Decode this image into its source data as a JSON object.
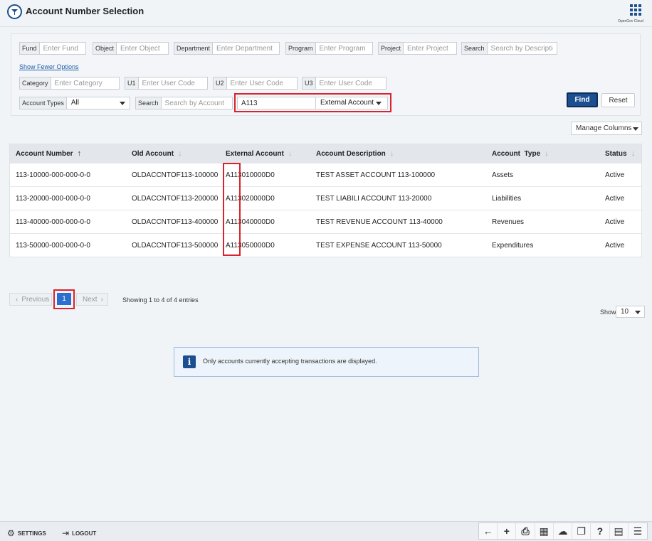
{
  "header": {
    "title": "Account Number Selection",
    "brand": "OpenGov Cloud"
  },
  "filters": {
    "fund": {
      "label": "Fund",
      "placeholder": "Enter Fund"
    },
    "object": {
      "label": "Object",
      "placeholder": "Enter Object"
    },
    "department": {
      "label": "Department",
      "placeholder": "Enter Department"
    },
    "program": {
      "label": "Program",
      "placeholder": "Enter Program"
    },
    "project": {
      "label": "Project",
      "placeholder": "Enter Project"
    },
    "search_desc": {
      "label": "Search",
      "placeholder": "Search by Description"
    },
    "show_fewer": "Show Fewer Options",
    "category": {
      "label": "Category",
      "placeholder": "Enter Category"
    },
    "u1": {
      "label": "U1",
      "placeholder": "Enter User Code"
    },
    "u2": {
      "label": "U2",
      "placeholder": "Enter User Code"
    },
    "u3": {
      "label": "U3",
      "placeholder": "Enter User Code"
    },
    "account_types": {
      "label": "Account Types",
      "value": "All"
    },
    "search_account": {
      "label": "Search",
      "placeholder": "Search by Account"
    },
    "account_value": "A113",
    "account_field_type": "External Account",
    "find_label": "Find",
    "reset_label": "Reset"
  },
  "manage_columns": "Manage Columns",
  "table": {
    "columns": [
      "Account Number",
      "Old Account",
      "External Account",
      "Account Description",
      "Account  Type",
      "Status"
    ],
    "rows": [
      [
        "113-10000-000-000-0-0",
        "OLDACCNTOF113-100000",
        "A113010000D0",
        "TEST ASSET ACCOUNT 113-100000",
        "Assets",
        "Active"
      ],
      [
        "113-20000-000-000-0-0",
        "OLDACCNTOF113-200000",
        "A113020000D0",
        "TEST LIABILI ACCOUNT 113-20000",
        "Liabilities",
        "Active"
      ],
      [
        "113-40000-000-000-0-0",
        "OLDACCNTOF113-400000",
        "A113040000D0",
        "TEST REVENUE ACCOUNT 113-40000",
        "Revenues",
        "Active"
      ],
      [
        "113-50000-000-000-0-0",
        "OLDACCNTOF113-500000",
        "A113050000D0",
        "TEST EXPENSE ACCOUNT 113-50000",
        "Expenditures",
        "Active"
      ]
    ]
  },
  "pagination": {
    "previous": "Previous",
    "current": "1",
    "next": "Next",
    "entries_text": "Showing 1 to 4 of 4 entries",
    "show_label": "Show",
    "page_size": "10"
  },
  "info_message": "Only accounts currently accepting transactions are displayed.",
  "footer": {
    "settings": "SETTINGS",
    "logout": "LOGOUT"
  },
  "toolbar_icons": [
    "back-arrow-icon",
    "plus-icon",
    "printer-icon",
    "grid-table-icon",
    "cloud-link-icon",
    "copy-icon",
    "help-icon",
    "calendar-notes-icon",
    "hierarchy-icon"
  ]
}
